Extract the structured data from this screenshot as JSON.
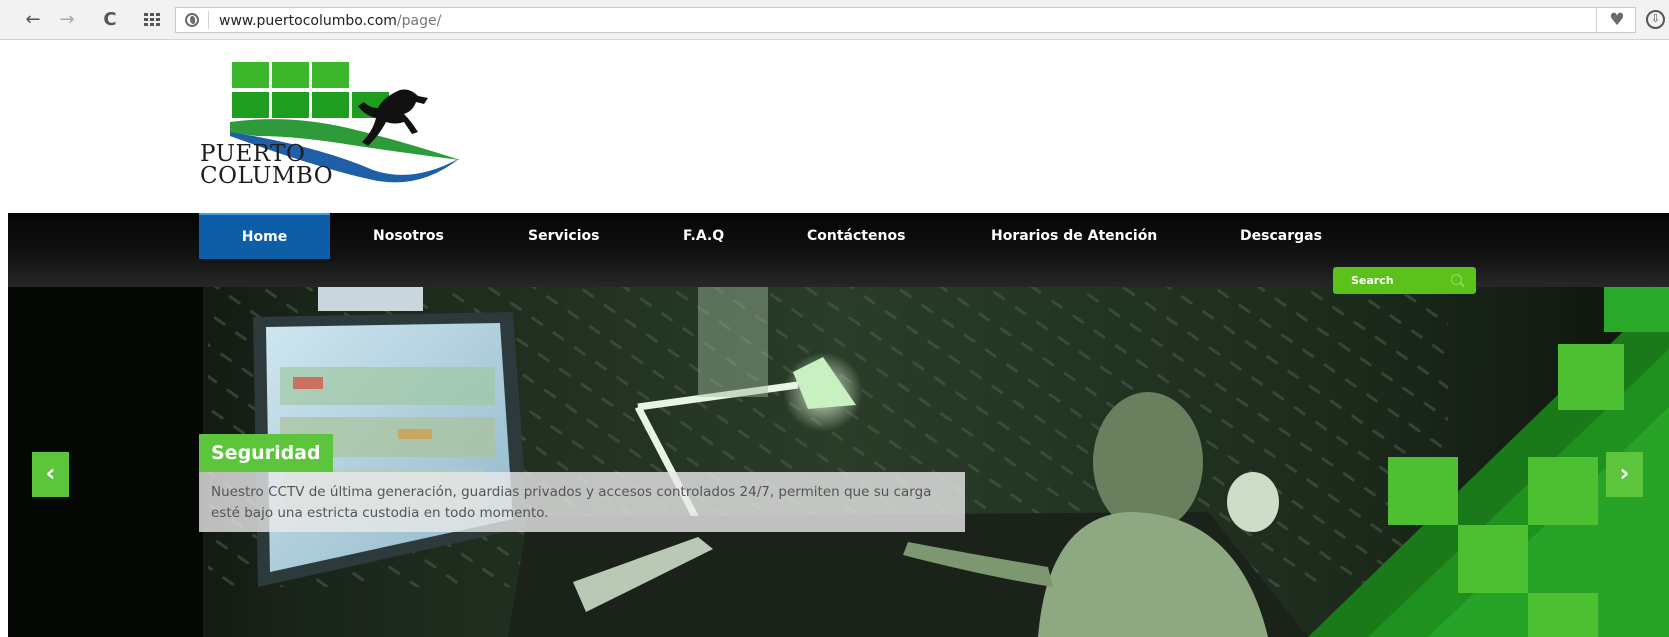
{
  "browser": {
    "url_host": "www.puertocolumbo.com",
    "url_path": "/page/",
    "back_icon": "←",
    "forward_icon": "→",
    "reload_icon": "C",
    "heart_icon": "♥",
    "download_icon": "⇩"
  },
  "logo": {
    "line1": "PUERTO",
    "line2": "COLUMBO",
    "horse_icon": "horse-icon"
  },
  "nav": {
    "items": [
      {
        "label": "Home",
        "active": true
      },
      {
        "label": "Nosotros"
      },
      {
        "label": "Servicios"
      },
      {
        "label": "F.A.Q"
      },
      {
        "label": "Contáctenos"
      },
      {
        "label": "Horarios de Atención"
      },
      {
        "label": "Descargas"
      }
    ]
  },
  "search": {
    "placeholder": "Search"
  },
  "slider": {
    "title": "Seguridad",
    "caption_line1": "Nuestro CCTV de última generación, guardias privados y accesos controlados 24/7, permiten que su carga",
    "caption_line2": "esté bajo una estricta custodia en todo momento.",
    "prev_icon": "‹",
    "next_icon": "›"
  },
  "colors": {
    "brand_green": "#5cc53c",
    "nav_active_blue": "#0d5ea6",
    "nav_bg": "#111111"
  }
}
